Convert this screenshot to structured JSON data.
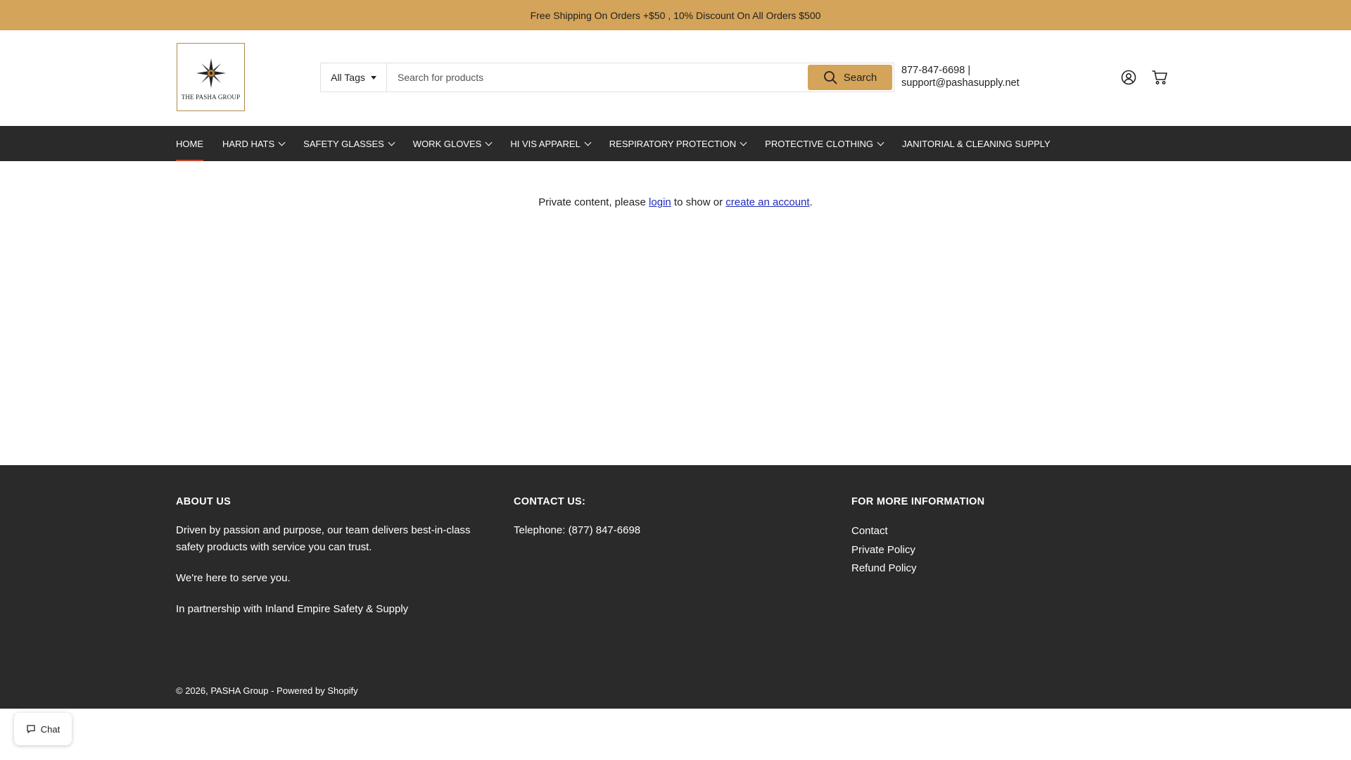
{
  "announcement": {
    "text": "Free Shipping On Orders +$50 , 10% Discount On All Orders $500"
  },
  "header": {
    "logo_text": "THE PASHA GROUP",
    "search": {
      "tags_label": "All Tags",
      "placeholder": "Search for products",
      "button_label": "Search"
    },
    "contact": {
      "phone": "877-847-6698 |",
      "email": "support@pashasupply.net"
    },
    "icons": [
      "account-icon",
      "cart-icon"
    ]
  },
  "nav": {
    "items": [
      {
        "label": "HOME",
        "active": true,
        "has_dropdown": false
      },
      {
        "label": "HARD HATS",
        "active": false,
        "has_dropdown": true
      },
      {
        "label": "SAFETY GLASSES",
        "active": false,
        "has_dropdown": true
      },
      {
        "label": "WORK GLOVES",
        "active": false,
        "has_dropdown": true
      },
      {
        "label": "HI VIS APPAREL",
        "active": false,
        "has_dropdown": true
      },
      {
        "label": "RESPIRATORY PROTECTION",
        "active": false,
        "has_dropdown": true
      },
      {
        "label": "PROTECTIVE CLOTHING",
        "active": false,
        "has_dropdown": true
      },
      {
        "label": "JANITORIAL & CLEANING SUPPLY",
        "active": false,
        "has_dropdown": false
      }
    ]
  },
  "main": {
    "message_before": "Private content, please ",
    "login_link": "login",
    "message_middle": " to show or ",
    "create_account_link": "create an account",
    "message_after": "."
  },
  "footer": {
    "about": {
      "title": "ABOUT US",
      "paragraphs": [
        "Driven by passion and purpose, our team delivers best-in-class safety products with service you can trust.",
        "We're here to serve you.",
        "In partnership with Inland Empire Safety & Supply"
      ]
    },
    "contact": {
      "title": "CONTACT US:",
      "telephone": "Telephone: (877) 847-6698"
    },
    "more_info": {
      "title": "FOR MORE INFORMATION",
      "links": [
        "Contact",
        "Private Policy",
        "Refund Policy"
      ]
    },
    "copyright_prefix": "© 2026, ",
    "copyright_brand": "PASHA Group",
    "copyright_separator": " - ",
    "copyright_powered": "Powered by Shopify"
  },
  "chat": {
    "label": "Chat"
  },
  "colors": {
    "accent": "#d4a45a",
    "dark": "#2a2a2a",
    "active_underline": "#c2462f",
    "link": "#1f2bb8"
  }
}
